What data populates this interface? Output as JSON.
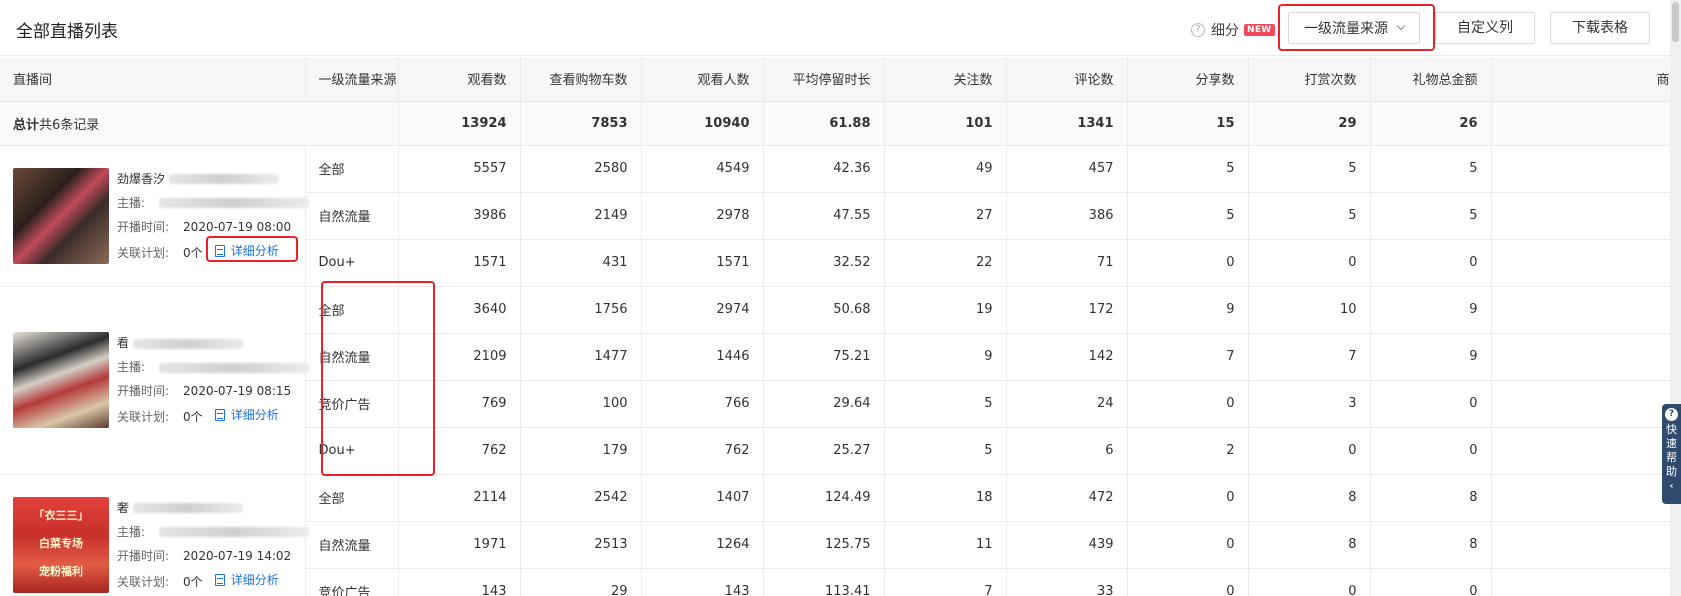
{
  "header": {
    "title": "全部直播列表",
    "detail_label": "细分",
    "new_badge": "NEW",
    "select_value": "一级流量来源",
    "custom_columns_label": "自定义列",
    "download_label": "下载表格"
  },
  "table": {
    "columns": [
      "直播间",
      "一级流量来源",
      "观看数",
      "查看购物车数",
      "观看人数",
      "平均停留时长",
      "关注数",
      "评论数",
      "分享数",
      "打赏次数",
      "礼物总金额",
      "商品"
    ],
    "total": {
      "label": "总计",
      "records": "共6条记录",
      "values": [
        "13924",
        "7853",
        "10940",
        "61.88",
        "101",
        "1341",
        "15",
        "29",
        "26"
      ]
    },
    "rooms": [
      {
        "name": "劲爆香汐",
        "host_label": "主播:",
        "start_label": "开播时间:",
        "start_time": "2020-07-19 08:00",
        "plan_label": "关联计划:",
        "plan_value": "0个",
        "detail_link": "详细分析",
        "rows": [
          {
            "source": "全部",
            "values": [
              "5557",
              "2580",
              "4549",
              "42.36",
              "49",
              "457",
              "5",
              "5",
              "5"
            ]
          },
          {
            "source": "自然流量",
            "values": [
              "3986",
              "2149",
              "2978",
              "47.55",
              "27",
              "386",
              "5",
              "5",
              "5"
            ]
          },
          {
            "source": "Dou+",
            "values": [
              "1571",
              "431",
              "1571",
              "32.52",
              "22",
              "71",
              "0",
              "0",
              "0"
            ]
          }
        ]
      },
      {
        "name": "看",
        "host_label": "主播:",
        "start_label": "开播时间:",
        "start_time": "2020-07-19 08:15",
        "plan_label": "关联计划:",
        "plan_value": "0个",
        "detail_link": "详细分析",
        "rows": [
          {
            "source": "全部",
            "values": [
              "3640",
              "1756",
              "2974",
              "50.68",
              "19",
              "172",
              "9",
              "10",
              "9"
            ]
          },
          {
            "source": "自然流量",
            "values": [
              "2109",
              "1477",
              "1446",
              "75.21",
              "9",
              "142",
              "7",
              "7",
              "9"
            ]
          },
          {
            "source": "竞价广告",
            "values": [
              "769",
              "100",
              "766",
              "29.64",
              "5",
              "24",
              "0",
              "3",
              "0"
            ]
          },
          {
            "source": "Dou+",
            "values": [
              "762",
              "179",
              "762",
              "25.27",
              "5",
              "6",
              "2",
              "0",
              "0"
            ]
          }
        ]
      },
      {
        "name": "奢",
        "host_label": "主播:",
        "start_label": "开播时间:",
        "start_time": "2020-07-19 14:02",
        "plan_label": "关联计划:",
        "plan_value": "0个",
        "detail_link": "详细分析",
        "thumb_text": [
          "「衣三三」",
          "白菜专场",
          "宠粉福利"
        ],
        "rows": [
          {
            "source": "全部",
            "values": [
              "2114",
              "2542",
              "1407",
              "124.49",
              "18",
              "472",
              "0",
              "8",
              "8"
            ]
          },
          {
            "source": "自然流量",
            "values": [
              "1971",
              "2513",
              "1264",
              "125.75",
              "11",
              "439",
              "0",
              "8",
              "8"
            ]
          },
          {
            "source": "竞价广告",
            "values": [
              "143",
              "29",
              "143",
              "113.41",
              "7",
              "33",
              "0",
              "0",
              "0"
            ]
          }
        ]
      }
    ]
  },
  "help_widget": {
    "label": "快速帮助"
  }
}
